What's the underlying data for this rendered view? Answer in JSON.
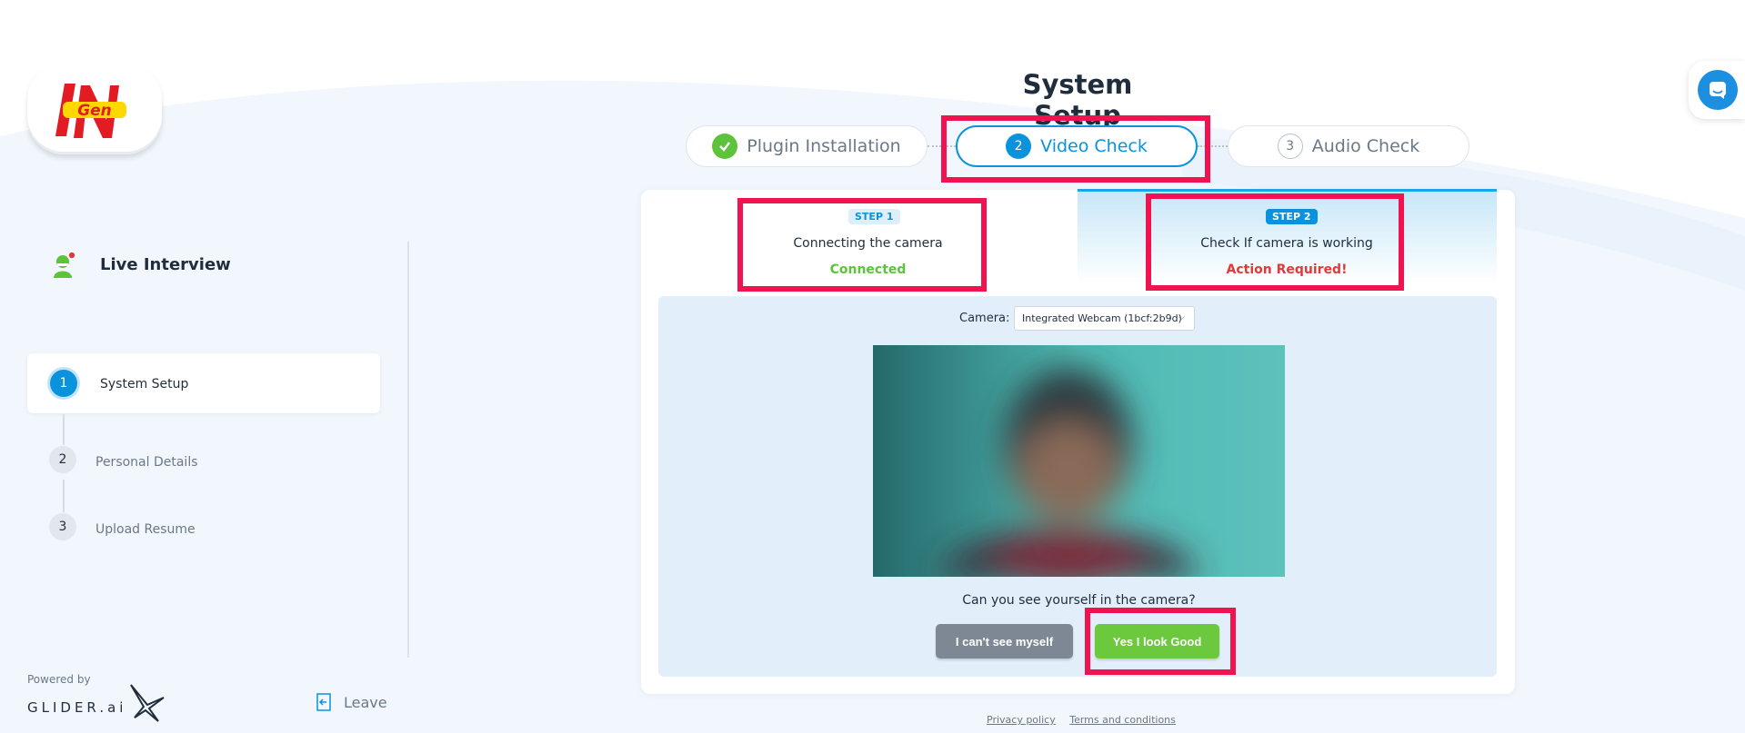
{
  "header": {
    "title": "System Setup"
  },
  "tabs": [
    {
      "number": "",
      "label": "Plugin Installation",
      "state": "done"
    },
    {
      "number": "2",
      "label": "Video Check",
      "state": "current"
    },
    {
      "number": "3",
      "label": "Audio Check",
      "state": "todo"
    }
  ],
  "sidebar": {
    "section_title": "Live Interview",
    "items": [
      {
        "number": "1",
        "label": "System Setup",
        "state": "active"
      },
      {
        "number": "2",
        "label": "Personal Details",
        "state": "inactive"
      },
      {
        "number": "3",
        "label": "Upload Resume",
        "state": "inactive"
      }
    ],
    "powered_by": "Powered by",
    "brand": "GLIDER.ai",
    "leave_label": "Leave"
  },
  "video_check": {
    "step1": {
      "pill": "STEP 1",
      "title": "Connecting the camera",
      "status": "Connected"
    },
    "step2": {
      "pill": "STEP 2",
      "title": "Check If camera is working",
      "status": "Action Required!"
    },
    "camera_label": "Camera:",
    "camera_selected": "Integrated Webcam (1bcf:2b9d)",
    "question": "Can you see yourself in the camera?",
    "cant_see_label": "I can't see myself",
    "look_good_label": "Yes I look Good"
  },
  "footer": {
    "privacy": "Privacy policy",
    "terms": "Terms and conditions"
  },
  "colors": {
    "accent": "#0a93dc",
    "success": "#6cc83c",
    "danger": "#e23a3a",
    "highlight": "#f0134f"
  }
}
